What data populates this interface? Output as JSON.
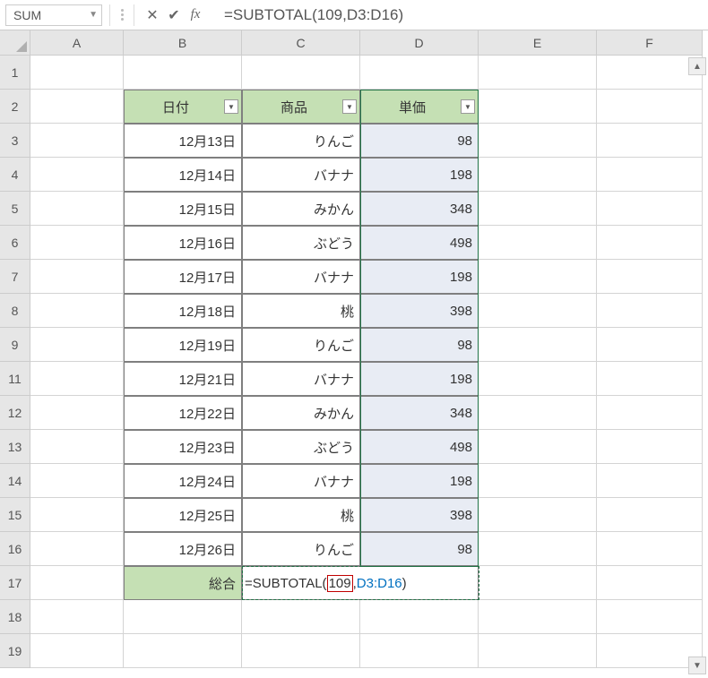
{
  "nameBox": "SUM",
  "formulaBar": "=SUBTOTAL(109,D3:D16)",
  "columns": [
    "A",
    "B",
    "C",
    "D",
    "E",
    "F"
  ],
  "rowNumbers": [
    1,
    2,
    3,
    4,
    5,
    6,
    7,
    8,
    9,
    11,
    12,
    13,
    14,
    15,
    16,
    17,
    18,
    19
  ],
  "headers": {
    "b": "日付",
    "c": "商品",
    "d": "単価"
  },
  "rows": [
    {
      "b": "12月13日",
      "c": "りんご",
      "d": "98"
    },
    {
      "b": "12月14日",
      "c": "バナナ",
      "d": "198"
    },
    {
      "b": "12月15日",
      "c": "みかん",
      "d": "348"
    },
    {
      "b": "12月16日",
      "c": "ぶどう",
      "d": "498"
    },
    {
      "b": "12月17日",
      "c": "バナナ",
      "d": "198"
    },
    {
      "b": "12月18日",
      "c": "桃",
      "d": "398"
    },
    {
      "b": "12月19日",
      "c": "りんご",
      "d": "98"
    },
    {
      "b": "12月21日",
      "c": "バナナ",
      "d": "198"
    },
    {
      "b": "12月22日",
      "c": "みかん",
      "d": "348"
    },
    {
      "b": "12月23日",
      "c": "ぶどう",
      "d": "498"
    },
    {
      "b": "12月24日",
      "c": "バナナ",
      "d": "198"
    },
    {
      "b": "12月25日",
      "c": "桃",
      "d": "398"
    },
    {
      "b": "12月26日",
      "c": "りんご",
      "d": "98"
    }
  ],
  "totalLabel": "総合",
  "editCell": {
    "prefix": "=SUBTOTAL(",
    "arg1": "109",
    "sep": ",",
    "ref": "D3:D16",
    "suffix": ")"
  }
}
